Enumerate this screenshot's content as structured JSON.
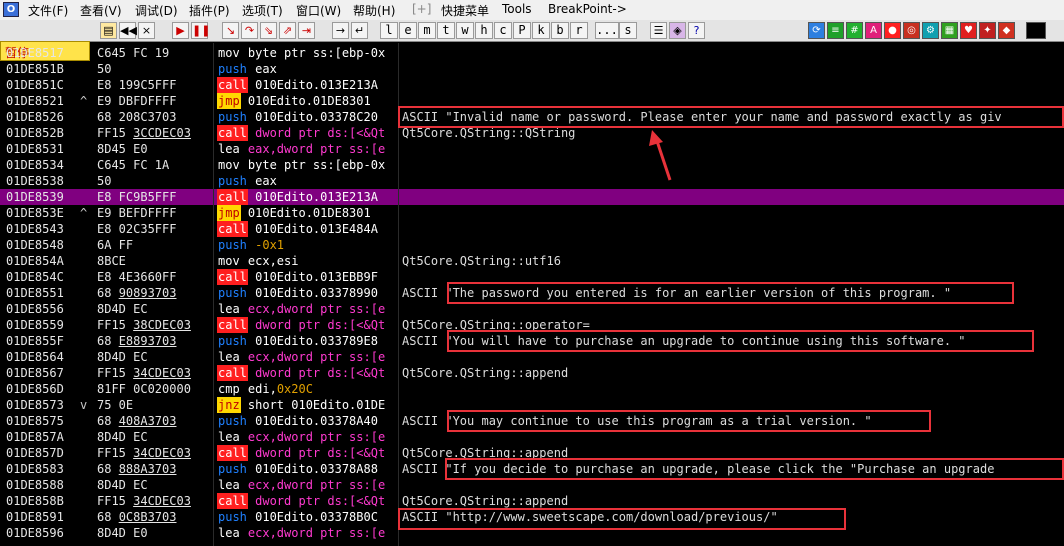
{
  "menubar": {
    "items": [
      "文件(F)",
      "查看(V)",
      "调试(D)",
      "插件(P)",
      "选项(T)",
      "窗口(W)",
      "帮助(H)",
      "[+]",
      "快捷菜单",
      "Tools",
      "BreakPoint->"
    ]
  },
  "status_label": "暂停",
  "toolbar": {
    "letters": [
      "l",
      "e",
      "m",
      "t",
      "w",
      "h",
      "c",
      "P",
      "k",
      "b",
      "r",
      "...",
      "s"
    ]
  },
  "listing": {
    "highlight_address": "01DE8539",
    "rows": [
      {
        "addr": "01DE8517",
        "mark": "",
        "hex": "C645 FC 19",
        "asm": [
          {
            "t": "mov",
            "c": "m-mov"
          },
          {
            "t": " byte ptr ss:[ebp-0x",
            "c": "o-bar"
          }
        ],
        "comment": ""
      },
      {
        "addr": "01DE851B",
        "mark": "",
        "hex": "50",
        "asm": [
          {
            "t": "push",
            "c": "m-push"
          },
          {
            "t": " eax",
            "c": "o-reg"
          }
        ],
        "comment": ""
      },
      {
        "addr": "01DE851C",
        "mark": "",
        "hex": "E8 199C5FFF",
        "asm": [
          {
            "t": "call",
            "c": "m-call"
          },
          {
            "t": " 010Edito.013E213A",
            "c": "o-bar"
          }
        ],
        "comment": ""
      },
      {
        "addr": "01DE8521",
        "mark": "^",
        "hex": "E9 DBFDFFFF",
        "asm": [
          {
            "t": "jmp",
            "c": "m-jmp"
          },
          {
            "t": " 010Edito.01DE8301",
            "c": "o-bar"
          }
        ],
        "comment": ""
      },
      {
        "addr": "01DE8526",
        "mark": "",
        "hex": "68 208C3703",
        "asm": [
          {
            "t": "push",
            "c": "m-push"
          },
          {
            "t": " 010Edito.03378C20",
            "c": "o-bar"
          }
        ],
        "comment": "ASCII \"Invalid name or password. Please enter your name and password exactly as giv"
      },
      {
        "addr": "01DE852B",
        "mark": "",
        "hex": "FF15 3CCDEC03",
        "ul": "3CCDEC03",
        "asm": [
          {
            "t": "call",
            "c": "m-call"
          },
          {
            "t": " dword ptr ds:[<&Qt",
            "c": "o-pt"
          }
        ],
        "comment": "Qt5Core.QString::QString"
      },
      {
        "addr": "01DE8531",
        "mark": "",
        "hex": "8D45 E0",
        "asm": [
          {
            "t": "lea",
            "c": "m-lea"
          },
          {
            "t": " eax,dword ptr ss:[e",
            "c": "o-pt"
          }
        ],
        "comment": ""
      },
      {
        "addr": "01DE8534",
        "mark": "",
        "hex": "C645 FC 1A",
        "asm": [
          {
            "t": "mov",
            "c": "m-mov"
          },
          {
            "t": " byte ptr ss:[ebp-0x",
            "c": "o-bar"
          }
        ],
        "comment": ""
      },
      {
        "addr": "01DE8538",
        "mark": "",
        "hex": "50",
        "asm": [
          {
            "t": "push",
            "c": "m-push"
          },
          {
            "t": " eax",
            "c": "o-reg"
          }
        ],
        "comment": ""
      },
      {
        "addr": "01DE8539",
        "mark": "",
        "hex": "E8 FC9B5FFF",
        "asm": [
          {
            "t": "call",
            "c": "m-call"
          },
          {
            "t": " 010Edito.013E213A",
            "c": "o-bar"
          }
        ],
        "comment": ""
      },
      {
        "addr": "01DE853E",
        "mark": "^",
        "hex": "E9 BEFDFFFF",
        "asm": [
          {
            "t": "jmp",
            "c": "m-jmp"
          },
          {
            "t": " 010Edito.01DE8301",
            "c": "o-bar"
          }
        ],
        "comment": ""
      },
      {
        "addr": "01DE8543",
        "mark": "",
        "hex": "E8 02C35FFF",
        "asm": [
          {
            "t": "call",
            "c": "m-call"
          },
          {
            "t": " 010Edito.013E484A",
            "c": "o-bar"
          }
        ],
        "comment": ""
      },
      {
        "addr": "01DE8548",
        "mark": "",
        "hex": "6A FF",
        "asm": [
          {
            "t": "push",
            "c": "m-push"
          },
          {
            "t": " -0x1",
            "c": "o-imm"
          }
        ],
        "comment": ""
      },
      {
        "addr": "01DE854A",
        "mark": "",
        "hex": "8BCE",
        "asm": [
          {
            "t": "mov",
            "c": "m-mov"
          },
          {
            "t": " ecx,esi",
            "c": "o-reg"
          }
        ],
        "comment": "Qt5Core.QString::utf16"
      },
      {
        "addr": "01DE854C",
        "mark": "",
        "hex": "E8 4E3660FF",
        "asm": [
          {
            "t": "call",
            "c": "m-call"
          },
          {
            "t": " 010Edito.013EBB9F",
            "c": "o-bar"
          }
        ],
        "comment": ""
      },
      {
        "addr": "01DE8551",
        "mark": "",
        "hex": "68 90893703",
        "ul": "90893703",
        "asm": [
          {
            "t": "push",
            "c": "m-push"
          },
          {
            "t": " 010Edito.03378990",
            "c": "o-bar"
          }
        ],
        "comment": "ASCII \"The password you entered is for an earlier version of this program. \""
      },
      {
        "addr": "01DE8556",
        "mark": "",
        "hex": "8D4D EC",
        "asm": [
          {
            "t": "lea",
            "c": "m-lea"
          },
          {
            "t": " ecx,dword ptr ss:[e",
            "c": "o-pt"
          }
        ],
        "comment": ""
      },
      {
        "addr": "01DE8559",
        "mark": "",
        "hex": "FF15 38CDEC03",
        "ul": "38CDEC03",
        "asm": [
          {
            "t": "call",
            "c": "m-call"
          },
          {
            "t": " dword ptr ds:[<&Qt",
            "c": "o-pt"
          }
        ],
        "comment": "Qt5Core.QString::operator="
      },
      {
        "addr": "01DE855F",
        "mark": "",
        "hex": "68 E8893703",
        "ul": "E8893703",
        "asm": [
          {
            "t": "push",
            "c": "m-push"
          },
          {
            "t": " 010Edito.033789E8",
            "c": "o-bar"
          }
        ],
        "comment": "ASCII \"You will have to purchase an upgrade to continue using this software. \""
      },
      {
        "addr": "01DE8564",
        "mark": "",
        "hex": "8D4D EC",
        "asm": [
          {
            "t": "lea",
            "c": "m-lea"
          },
          {
            "t": " ecx,dword ptr ss:[e",
            "c": "o-pt"
          }
        ],
        "comment": ""
      },
      {
        "addr": "01DE8567",
        "mark": "",
        "hex": "FF15 34CDEC03",
        "ul": "34CDEC03",
        "asm": [
          {
            "t": "call",
            "c": "m-call"
          },
          {
            "t": " dword ptr ds:[<&Qt",
            "c": "o-pt"
          }
        ],
        "comment": "Qt5Core.QString::append"
      },
      {
        "addr": "01DE856D",
        "mark": "",
        "hex": "81FF 0C020000",
        "asm": [
          {
            "t": "cmp",
            "c": "m-cmp"
          },
          {
            "t": " edi,",
            "c": "o-reg"
          },
          {
            "t": "0x20C",
            "c": "o-imm"
          }
        ],
        "comment": ""
      },
      {
        "addr": "01DE8573",
        "mark": "v",
        "hex": "75 0E",
        "asm": [
          {
            "t": "jnz",
            "c": "m-jnz"
          },
          {
            "t": " short 010Edito.01DE",
            "c": "o-bar"
          }
        ],
        "comment": ""
      },
      {
        "addr": "01DE8575",
        "mark": "",
        "hex": "68 408A3703",
        "ul": "408A3703",
        "asm": [
          {
            "t": "push",
            "c": "m-push"
          },
          {
            "t": " 010Edito.03378A40",
            "c": "o-bar"
          }
        ],
        "comment": "ASCII \"You may continue to use this program as a trial version. \""
      },
      {
        "addr": "01DE857A",
        "mark": "",
        "hex": "8D4D EC",
        "asm": [
          {
            "t": "lea",
            "c": "m-lea"
          },
          {
            "t": " ecx,dword ptr ss:[e",
            "c": "o-pt"
          }
        ],
        "comment": ""
      },
      {
        "addr": "01DE857D",
        "mark": "",
        "hex": "FF15 34CDEC03",
        "ul": "34CDEC03",
        "asm": [
          {
            "t": "call",
            "c": "m-call"
          },
          {
            "t": " dword ptr ds:[<&Qt",
            "c": "o-pt"
          }
        ],
        "comment": "Qt5Core.QString::append"
      },
      {
        "addr": "01DE8583",
        "mark": "",
        "hex": "68 888A3703",
        "ul": "888A3703",
        "asm": [
          {
            "t": "push",
            "c": "m-push"
          },
          {
            "t": " 010Edito.03378A88",
            "c": "o-bar"
          }
        ],
        "comment": "ASCII \"If you decide to purchase an upgrade, please click the \"Purchase an upgrade"
      },
      {
        "addr": "01DE8588",
        "mark": "",
        "hex": "8D4D EC",
        "asm": [
          {
            "t": "lea",
            "c": "m-lea"
          },
          {
            "t": " ecx,dword ptr ss:[e",
            "c": "o-pt"
          }
        ],
        "comment": ""
      },
      {
        "addr": "01DE858B",
        "mark": "",
        "hex": "FF15 34CDEC03",
        "ul": "34CDEC03",
        "asm": [
          {
            "t": "call",
            "c": "m-call"
          },
          {
            "t": " dword ptr ds:[<&Qt",
            "c": "o-pt"
          }
        ],
        "comment": "Qt5Core.QString::append"
      },
      {
        "addr": "01DE8591",
        "mark": "",
        "hex": "68 0C8B3703",
        "ul": "0C8B3703",
        "asm": [
          {
            "t": "push",
            "c": "m-push"
          },
          {
            "t": " 010Edito.03378B0C",
            "c": "o-bar"
          }
        ],
        "comment": "ASCII \"http://www.sweetscape.com/download/previous/\""
      },
      {
        "addr": "01DE8596",
        "mark": "",
        "hex": "8D4D E0",
        "asm": [
          {
            "t": "lea",
            "c": "m-lea"
          },
          {
            "t": " ecx,dword ptr ss:[e",
            "c": "o-pt"
          }
        ],
        "comment": ""
      }
    ]
  },
  "colors": {
    "highlight": "#800080",
    "call": "#ff1f1f",
    "jump": "#ffd800",
    "push": "#1f80ff",
    "annotation": "#e8323a"
  }
}
